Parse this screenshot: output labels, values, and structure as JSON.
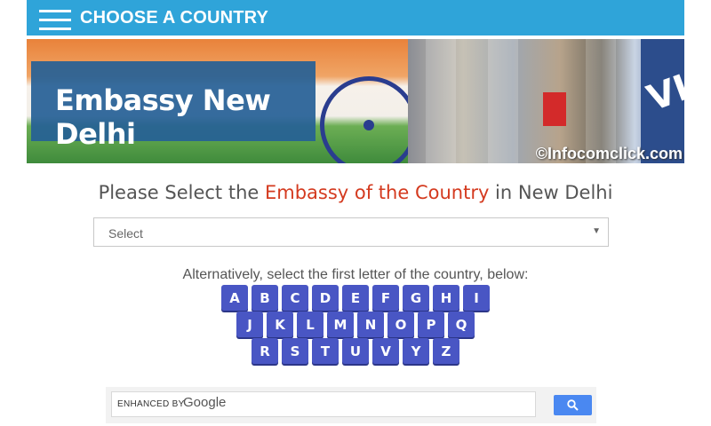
{
  "header": {
    "title": "CHOOSE A COUNTRY",
    "menu_icon": "hamburger-menu-icon"
  },
  "banner": {
    "title": "Embassy New Delhi",
    "watermark": "©Infocomclick.com"
  },
  "heading": {
    "prefix": "Please Select the ",
    "accent": "Embassy of the Country",
    "suffix": " in New Delhi",
    "accent_color": "#d43a1f"
  },
  "select": {
    "value": "Select"
  },
  "alphabet": {
    "intro": "Alternatively, select the first letter of the country, below:",
    "rows": [
      [
        "A",
        "B",
        "C",
        "D",
        "E",
        "F",
        "G",
        "H",
        "I"
      ],
      [
        "J",
        "K",
        "L",
        "M",
        "N",
        "O",
        "P",
        "Q"
      ],
      [
        "R",
        "S",
        "T",
        "U",
        "V",
        "Y",
        "Z"
      ]
    ],
    "button_color": "#4956c4"
  },
  "search": {
    "label": "ENHANCED BY",
    "brand": "Google",
    "button_icon": "search-icon"
  },
  "colors": {
    "topbar": "#2fa4d9",
    "title_box": "#255f96",
    "search_button": "#4a88f1"
  }
}
